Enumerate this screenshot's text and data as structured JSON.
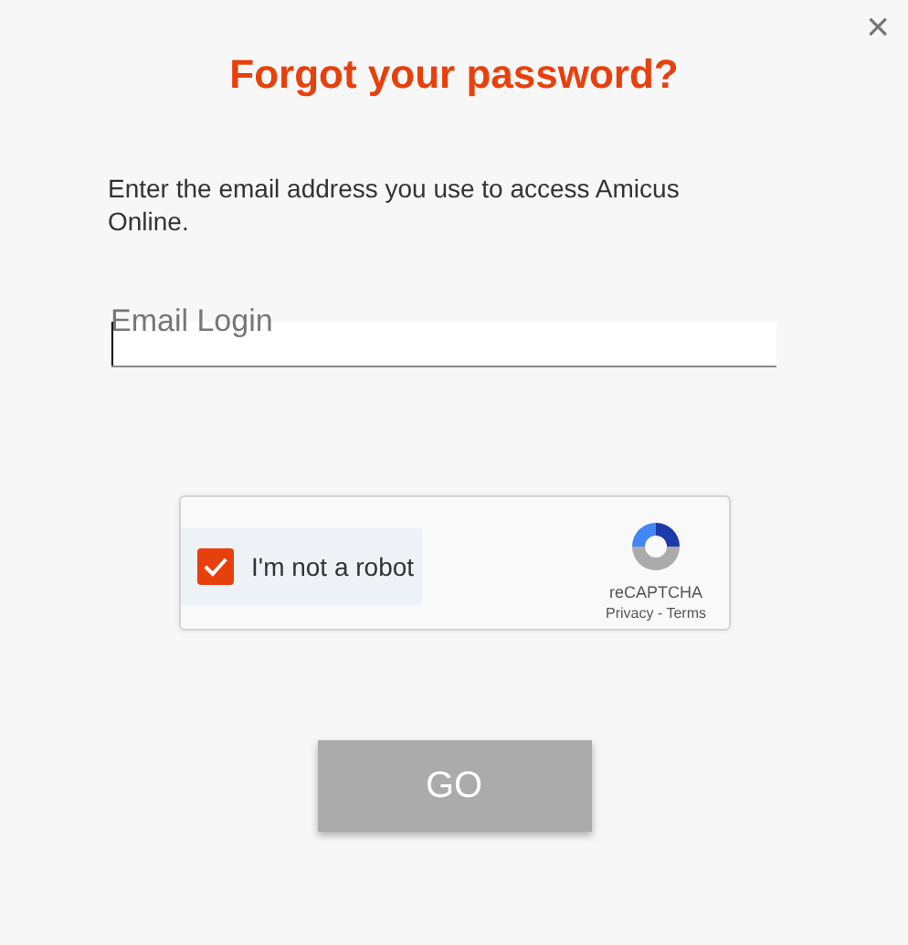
{
  "dialog": {
    "close": "×",
    "title": "Forgot your password?",
    "instructions": "Enter the email address you use to access Amicus Online."
  },
  "email_field": {
    "label": "Email Login"
  },
  "captcha": {
    "label": "I'm not a robot",
    "checked": true,
    "brand": "reCAPTCHA",
    "links": [
      "Privacy",
      "Terms"
    ],
    "separator": " - "
  },
  "buttons": [
    {
      "label": "GO",
      "disabled": true
    }
  ]
}
